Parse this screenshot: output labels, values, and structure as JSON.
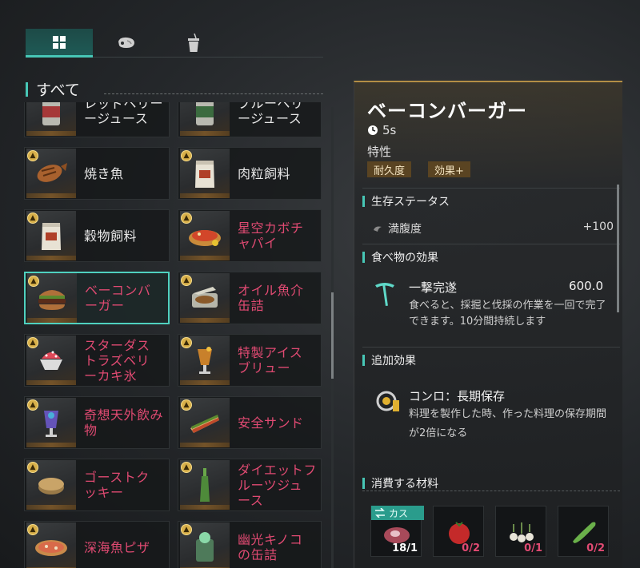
{
  "tabs": [
    {
      "name": "all",
      "icon": "grid-icon",
      "active": true
    },
    {
      "name": "meat",
      "icon": "meat-icon",
      "active": false
    },
    {
      "name": "drink",
      "icon": "cup-icon",
      "active": false
    }
  ],
  "section_title": "すべて",
  "grid": {
    "items": [
      {
        "label": "レッドベリー\nージュース",
        "locked": false,
        "badge": false,
        "icon": "red-berry-juice-can-icon"
      },
      {
        "label": "ブルーベリ\nージュース",
        "locked": false,
        "badge": false,
        "icon": "blue-berry-juice-can-icon"
      },
      {
        "label": "焼き魚",
        "locked": false,
        "badge": true,
        "icon": "grilled-fish-icon"
      },
      {
        "label": "肉粒飼料",
        "locked": false,
        "badge": true,
        "icon": "meat-feed-bag-icon"
      },
      {
        "label": "穀物飼料",
        "locked": false,
        "badge": true,
        "icon": "grain-feed-bag-icon"
      },
      {
        "label": "星空カボチ\nャパイ",
        "locked": true,
        "badge": true,
        "icon": "pumpkin-pie-icon"
      },
      {
        "label": "ベーコンバ\nーガー",
        "locked": true,
        "badge": true,
        "icon": "bacon-burger-icon",
        "selected": true
      },
      {
        "label": "オイル魚介\n缶詰",
        "locked": true,
        "badge": true,
        "icon": "canned-seafood-icon"
      },
      {
        "label": "スターダス\nトラズベリ\nーカキ氷",
        "locked": true,
        "badge": true,
        "icon": "shaved-ice-icon"
      },
      {
        "label": "特製アイス\nブリュー",
        "locked": true,
        "badge": true,
        "icon": "iced-brew-icon"
      },
      {
        "label": "奇想天外飲み\n物",
        "locked": true,
        "badge": true,
        "icon": "fancy-drink-icon"
      },
      {
        "label": "安全サンド",
        "locked": true,
        "badge": true,
        "icon": "sandwich-icon"
      },
      {
        "label": "ゴーストク\nッキー",
        "locked": true,
        "badge": true,
        "icon": "cookie-icon"
      },
      {
        "label": "ダイエットフ\nルーツジュ\nース",
        "locked": true,
        "badge": true,
        "icon": "fruit-juice-bottle-icon"
      },
      {
        "label": "深海魚ピザ",
        "locked": true,
        "badge": true,
        "icon": "pizza-icon"
      },
      {
        "label": "幽光キノコ\nの缶詰",
        "locked": true,
        "badge": true,
        "icon": "canned-mushroom-icon"
      }
    ]
  },
  "detail": {
    "title": "ベーコンバーガー",
    "time": "5s",
    "trait_label": "特性",
    "traits": [
      "耐久度",
      "効果+"
    ],
    "survival_title": "生存ステータス",
    "stat": {
      "name": "満腹度",
      "value": "+100"
    },
    "food_effect_title": "食べ物の効果",
    "effect": {
      "name": "一撃完遂",
      "value": "600.0",
      "desc": "食べると、採掘と伐採の作業を一回で完了できます。10分間持続します"
    },
    "bonus_title": "追加効果",
    "bonus": {
      "name": "コンロ：長期保存",
      "desc": "料理を製作した時、作った料理の保存期間が2倍になる"
    },
    "materials_title": "消費する材料",
    "custom_label": "カス",
    "materials": [
      {
        "qty": "18/1",
        "short": false,
        "icon": "raw-meat-icon"
      },
      {
        "qty": "0/2",
        "short": true,
        "icon": "tomato-icon"
      },
      {
        "qty": "0/1",
        "short": true,
        "icon": "garlic-icon"
      },
      {
        "qty": "0/2",
        "short": true,
        "icon": "cucumber-icon"
      }
    ]
  },
  "colors": {
    "accent": "#47c7b6",
    "locked_text": "#e04a72",
    "gold": "#b38e45",
    "chip_bg": "#5a4422"
  }
}
